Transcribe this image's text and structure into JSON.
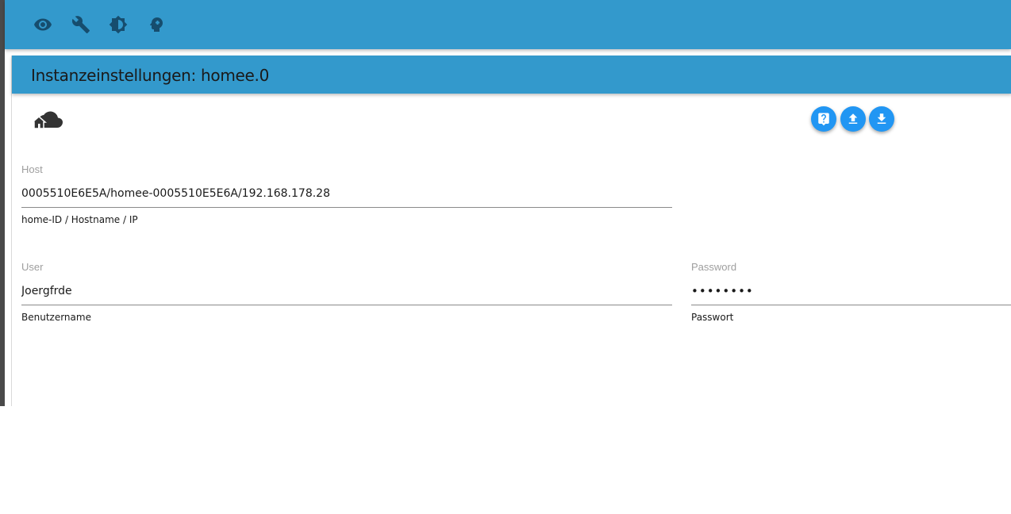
{
  "toolbar": {
    "icons": [
      "eye-icon",
      "wrench-icon",
      "brightness-icon",
      "head-icon"
    ]
  },
  "panel": {
    "title": "Instanzeinstellungen: homee.0"
  },
  "actions": {
    "icons": [
      "help-icon",
      "upload-icon",
      "download-icon"
    ],
    "accent_color": "#2196f3"
  },
  "form": {
    "host": {
      "label": "Host",
      "value": "0005510E6E5A/homee-0005510E5E6A/192.168.178.28",
      "help": "home-ID / Hostname / IP"
    },
    "user": {
      "label": "User",
      "value": "Joergfrde",
      "help": "Benutzername"
    },
    "password": {
      "label": "Password",
      "value": "••••••••",
      "help": "Passwort"
    }
  },
  "colors": {
    "header": "#3399cc",
    "icon_dark": "#164d6e"
  }
}
